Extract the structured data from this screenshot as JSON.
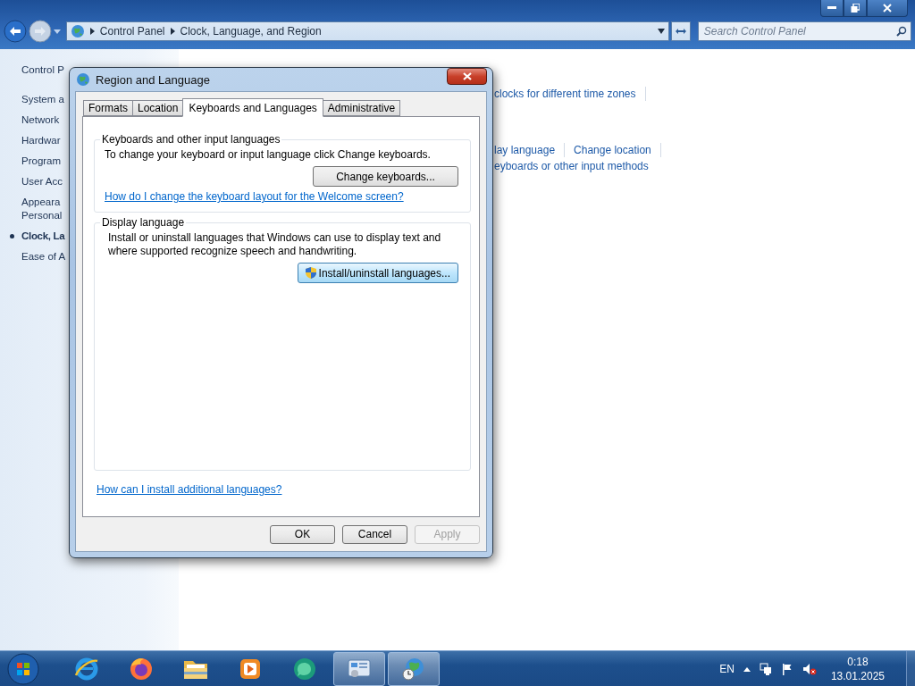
{
  "explorer": {
    "breadcrumb": [
      "Control Panel",
      "Clock, Language, and Region"
    ],
    "search": {
      "placeholder": "Search Control Panel"
    },
    "sidebar": {
      "items": [
        {
          "lines": [
            "Control P"
          ],
          "selected": false
        },
        {
          "lines": [
            "System a"
          ],
          "selected": false
        },
        {
          "lines": [
            "Network"
          ],
          "selected": false
        },
        {
          "lines": [
            "Hardwar"
          ],
          "selected": false
        },
        {
          "lines": [
            "Program"
          ],
          "selected": false
        },
        {
          "lines": [
            "User Acc"
          ],
          "selected": false
        },
        {
          "lines": [
            "Appeara",
            "Personal"
          ],
          "selected": false
        },
        {
          "lines": [
            "Clock, La"
          ],
          "selected": true
        },
        {
          "lines": [
            "Ease of A"
          ],
          "selected": false
        }
      ]
    },
    "link_rows": [
      [
        "clocks for different time zones"
      ],
      [
        "lay language",
        "Change location"
      ],
      [
        "eyboards or other input methods"
      ]
    ]
  },
  "dialog": {
    "title": "Region and Language",
    "tabs": [
      {
        "label": "Formats",
        "selected": false
      },
      {
        "label": "Location",
        "selected": false
      },
      {
        "label": "Keyboards and Languages",
        "selected": true
      },
      {
        "label": "Administrative",
        "selected": false
      }
    ],
    "groups": [
      {
        "title": "Keyboards and other input languages",
        "text": "To change your keyboard or input language click Change keyboards.",
        "button": {
          "label": "Change keyboards...",
          "focused": false,
          "shield": false
        },
        "link": "How do I change the keyboard layout for the Welcome screen?"
      },
      {
        "title": "Display language",
        "text": "Install or uninstall languages that Windows can use to display text and where supported recognize speech and handwriting.",
        "button": {
          "label": "Install/uninstall languages...",
          "focused": true,
          "shield": true
        }
      }
    ],
    "footer_link": "How can I install additional languages?",
    "buttons": [
      {
        "label": "OK",
        "disabled": false
      },
      {
        "label": "Cancel",
        "disabled": false
      },
      {
        "label": "Apply",
        "disabled": true
      }
    ]
  },
  "taskbar": {
    "buttons": [
      {
        "running": false
      },
      {
        "running": false
      },
      {
        "running": false
      },
      {
        "running": false
      },
      {
        "running": false
      },
      {
        "running": true
      },
      {
        "running": true
      }
    ],
    "language": "EN",
    "time": "0:18",
    "date": "13.01.2025"
  }
}
